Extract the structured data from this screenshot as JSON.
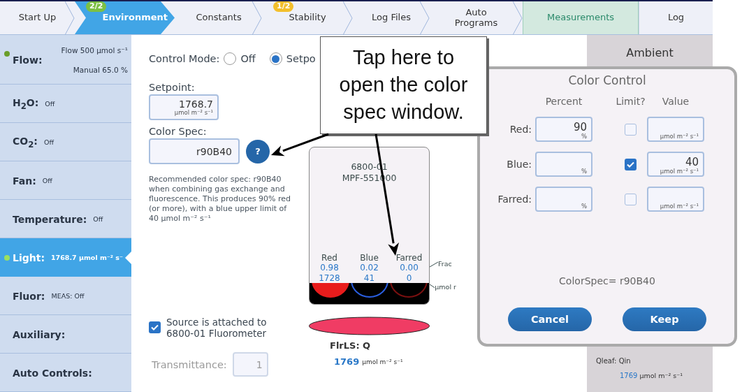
{
  "tabs": [
    {
      "label": "Start Up",
      "kind": "step",
      "selected": false,
      "highlighted": false
    },
    {
      "label": "Environment",
      "kind": "step",
      "selected": true,
      "highlighted": false,
      "badge": {
        "text": "2/2",
        "color": "#7cc043"
      }
    },
    {
      "label": "Constants",
      "kind": "step",
      "selected": false,
      "highlighted": false
    },
    {
      "label": "Stability",
      "kind": "step",
      "selected": false,
      "highlighted": false,
      "badge": {
        "text": "1/2",
        "color": "#f3bf2c"
      }
    },
    {
      "label": "Log Files",
      "kind": "step",
      "selected": false,
      "highlighted": false
    },
    {
      "label": "Auto Programs",
      "kind": "step",
      "selected": false,
      "highlighted": false
    },
    {
      "label": "Measurements",
      "kind": "page",
      "selected": false,
      "highlighted": true
    },
    {
      "label": "Log",
      "kind": "page",
      "selected": false,
      "highlighted": false
    }
  ],
  "sidebar": {
    "items": [
      {
        "label": "Flow:",
        "value": "Flow 500 µmol s⁻¹",
        "value_2": "Manual 65.0 %",
        "color": "#6a9e2a",
        "selected": false
      },
      {
        "label": "H$_{2}$O:",
        "value": "Off",
        "selected": false
      },
      {
        "label": "CO$_{2}$:",
        "value": "Off",
        "selected": false
      },
      {
        "label": "Fan:",
        "value": "Off",
        "selected": false
      },
      {
        "label": "Temperature:",
        "value": "Off",
        "selected": false
      },
      {
        "label": "Light:",
        "value": "1768.7 µmol m⁻² s⁻",
        "color": "#9be060",
        "selected": true
      },
      {
        "label": "Fluor:",
        "value": "MEAS: Off",
        "selected": false
      },
      {
        "label": "Auxiliary:",
        "selected": false
      },
      {
        "label": "Auto Controls:",
        "selected": false
      }
    ]
  },
  "control_mode": {
    "label": "Control Mode:",
    "options": [
      {
        "label": "Off",
        "selected": false
      },
      {
        "label": "Setpo",
        "selected": true
      }
    ]
  },
  "setpoint": {
    "label": "Setpoint:",
    "value": "1768.7",
    "unit": "µmol m⁻² s⁻¹"
  },
  "color_spec": {
    "label": "Color Spec:",
    "value": "r90B40",
    "help_button": "?"
  },
  "note": "Recommended color spec: r90B40 when combining gas exchange and fluorescence. This produces 90% red (or more), with a blue upper limit of 40 µmol m⁻² s⁻¹",
  "source_checkbox": {
    "label": "Source is attached to 6800-01 Fluorometer",
    "checked": true
  },
  "transmittance": {
    "label": "Transmittance:",
    "value": "1",
    "disabled": true
  },
  "device": {
    "model": "6800-01",
    "part": "MPF-551000",
    "channels": [
      {
        "name": "Red",
        "fraction": "0.98",
        "flux": "1728",
        "color": "#e81c1c"
      },
      {
        "name": "Blue",
        "fraction": "0.02",
        "flux": "41",
        "color": "#2a5ee0"
      },
      {
        "name": "Farred",
        "fraction": "0.00",
        "flux": "0",
        "color": "#7a1010"
      }
    ],
    "row_labels": [
      "Frac",
      "µmol r"
    ],
    "source": "FlrLS: Q",
    "reading": "1769",
    "unit": "µmol m⁻² s⁻¹"
  },
  "ambient": {
    "title": "Ambient",
    "source": "Qleaf: Qin",
    "reading": "1769",
    "unit": "µmol m⁻² s⁻¹"
  },
  "dialog": {
    "title": "Color Control",
    "columns": [
      "Percent",
      "Limit?",
      "Value"
    ],
    "rows": [
      {
        "label": "Red:",
        "percent": "90",
        "percent_unit": "%",
        "limit": false,
        "value_unit": "µmol m⁻² s⁻¹"
      },
      {
        "label": "Blue:",
        "percent_unit": "%",
        "limit": true,
        "value": "40",
        "value_unit": "µmol m⁻² s⁻¹"
      },
      {
        "label": "Farred:",
        "percent_unit": "%",
        "limit": false,
        "value_unit": "µmol m⁻² s⁻¹"
      }
    ],
    "summary": "ColorSpec= r90B40",
    "buttons": [
      "Cancel",
      "Keep"
    ]
  },
  "callout": "Tap here to open the color spec window."
}
